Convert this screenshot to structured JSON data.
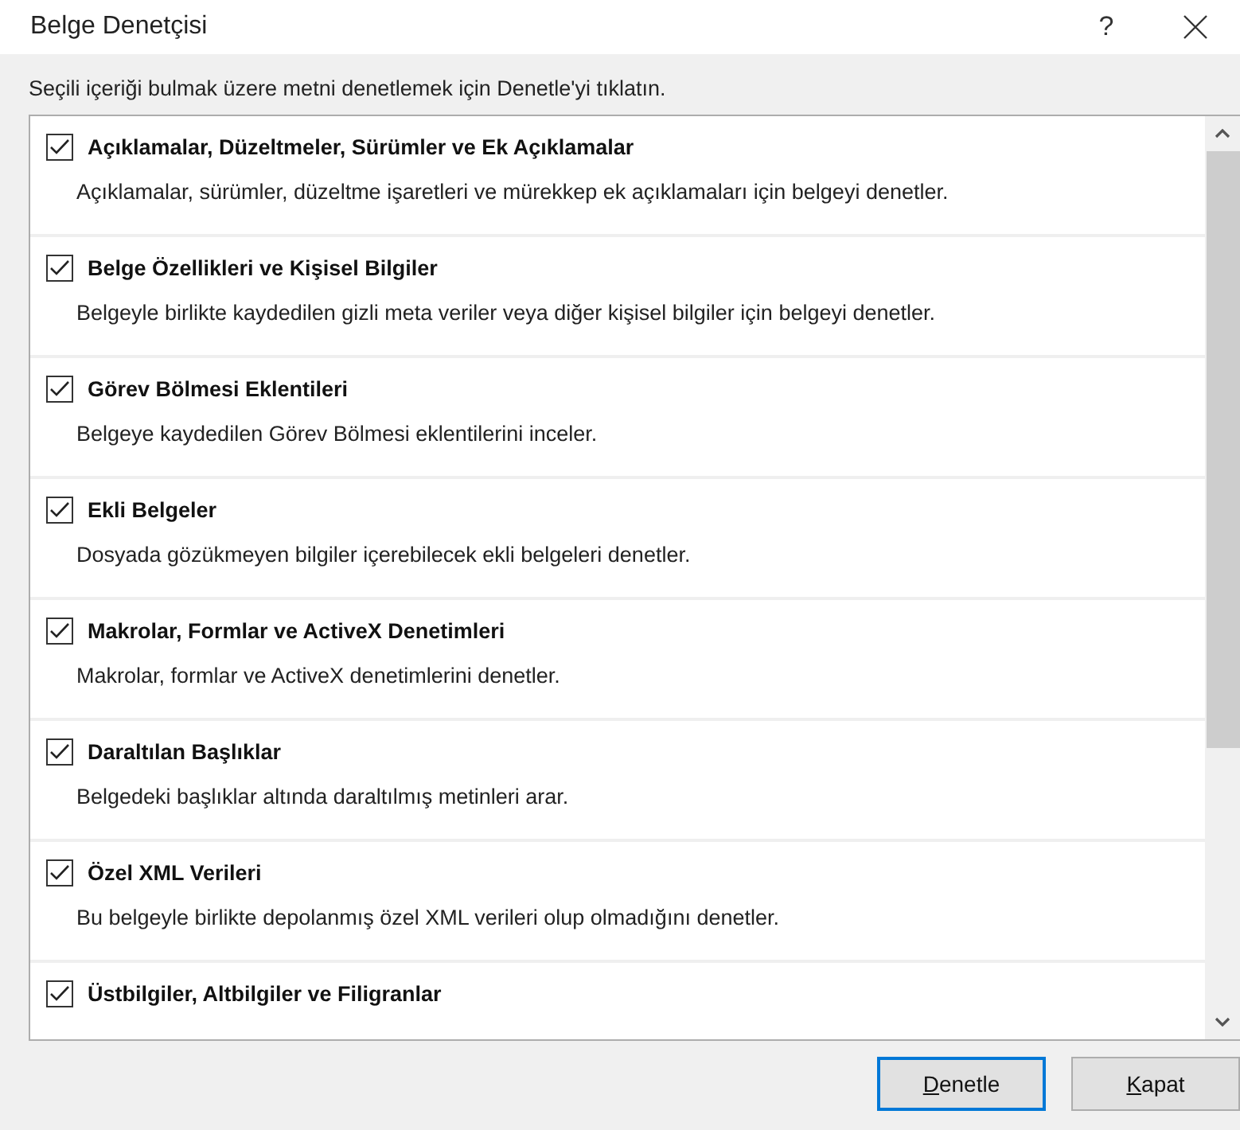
{
  "window": {
    "title": "Belge Denetçisi",
    "help": "?"
  },
  "instruction": "Seçili içeriği bulmak üzere metni denetlemek için Denetle'yi tıklatın.",
  "items": [
    {
      "title": "Açıklamalar, Düzeltmeler, Sürümler ve Ek Açıklamalar",
      "description": "Açıklamalar, sürümler, düzeltme işaretleri ve mürekkep ek açıklamaları için belgeyi denetler.",
      "checked": true
    },
    {
      "title": "Belge Özellikleri ve Kişisel Bilgiler",
      "description": "Belgeyle birlikte kaydedilen gizli meta veriler veya diğer kişisel bilgiler için belgeyi denetler.",
      "checked": true
    },
    {
      "title": "Görev Bölmesi Eklentileri",
      "description": "Belgeye kaydedilen Görev Bölmesi eklentilerini inceler.",
      "checked": true
    },
    {
      "title": "Ekli Belgeler",
      "description": "Dosyada gözükmeyen bilgiler içerebilecek ekli belgeleri denetler.",
      "checked": true
    },
    {
      "title": "Makrolar, Formlar ve ActiveX Denetimleri",
      "description": "Makrolar, formlar ve ActiveX denetimlerini denetler.",
      "checked": true
    },
    {
      "title": "Daraltılan Başlıklar",
      "description": "Belgedeki başlıklar altında daraltılmış metinleri arar.",
      "checked": true
    },
    {
      "title": "Özel XML Verileri",
      "description": "Bu belgeyle birlikte depolanmış özel XML verileri olup olmadığını denetler.",
      "checked": true
    },
    {
      "title": "Üstbilgiler, Altbilgiler ve Filigranlar",
      "checked": true
    }
  ],
  "buttons": [
    {
      "label": "Denetle",
      "default": true
    },
    {
      "label": "Kapat",
      "default": false
    }
  ]
}
